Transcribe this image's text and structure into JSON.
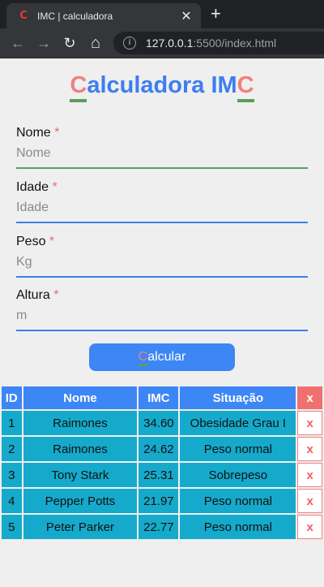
{
  "browser": {
    "tab_title": "IMC | calculadora",
    "favicon": "C",
    "close": "✕",
    "new_tab": "+",
    "url_host": "127.0.0.1",
    "url_rest": ":5500/index.html",
    "back": "←",
    "forward": "→",
    "reload": "↻",
    "home": "⌂",
    "info": "i"
  },
  "page": {
    "title_c1": "C",
    "title_mid": "alculadora IM",
    "title_c2": "C",
    "required_mark": "*",
    "fields": [
      {
        "label": "Nome",
        "placeholder": "Nome"
      },
      {
        "label": "Idade",
        "placeholder": "Idade"
      },
      {
        "label": "Peso",
        "placeholder": "Kg"
      },
      {
        "label": "Altura",
        "placeholder": "m"
      }
    ],
    "button_first": "C",
    "button_rest": "alcular"
  },
  "table": {
    "headers": [
      "ID",
      "Nome",
      "IMC",
      "Situação",
      "x"
    ],
    "rows": [
      {
        "id": "1",
        "nome": "Raimones",
        "imc": "34.60",
        "situacao": "Obesidade Grau I",
        "del": "x"
      },
      {
        "id": "2",
        "nome": "Raimones",
        "imc": "24.62",
        "situacao": "Peso normal",
        "del": "x"
      },
      {
        "id": "3",
        "nome": "Tony Stark",
        "imc": "25.31",
        "situacao": "Sobrepeso",
        "del": "x"
      },
      {
        "id": "4",
        "nome": "Pepper Potts",
        "imc": "21.97",
        "situacao": "Peso normal",
        "del": "x"
      },
      {
        "id": "5",
        "nome": "Peter Parker",
        "imc": "22.77",
        "situacao": "Peso normal",
        "del": "x"
      }
    ]
  },
  "colors": {
    "primary": "#3d86f6",
    "accent": "#f08080",
    "underline": "#57a05a",
    "row": "#15aacb",
    "delete": "#f07070"
  }
}
